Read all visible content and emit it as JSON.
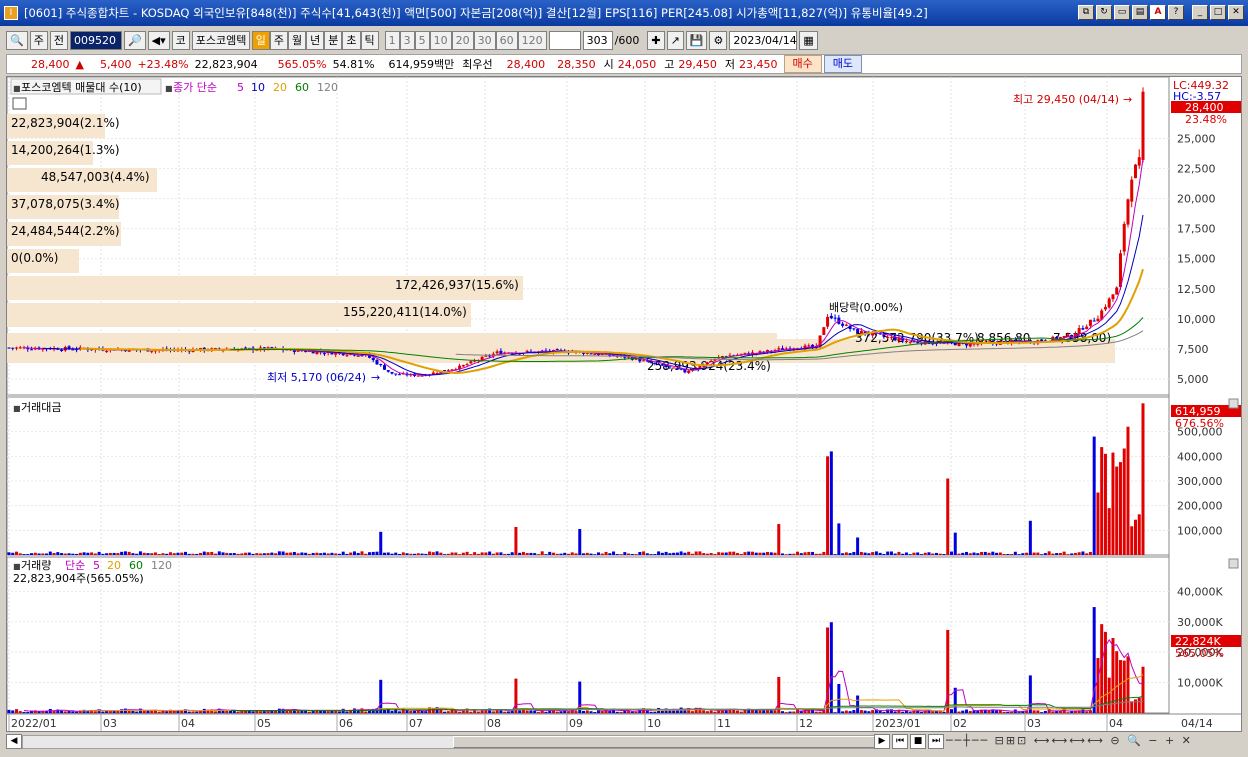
{
  "window": {
    "title": "[0601] 주식종합차트 - KOSDAQ 외국인보유[848(천)] 주식수[41,643(천)] 액면[500] 자본금[208(억)] 결산[12월] EPS[116] PER[245.08] 시가총액[11,827(억)] 유통비율[49.2]",
    "app_icon": "I"
  },
  "toolbar": {
    "market_select": "주",
    "prev_label": "전",
    "code": "009520",
    "stock_prefix": "코",
    "stock_name": "포스코엠텍",
    "periods": [
      "일",
      "주",
      "월",
      "년",
      "분",
      "초",
      "틱"
    ],
    "active_period": "일",
    "intervals": [
      "1",
      "3",
      "5",
      "10",
      "20",
      "30",
      "60",
      "120"
    ],
    "count": "303",
    "count_total": "/600",
    "date": "2023/04/14"
  },
  "quote": {
    "price": "28,400",
    "change": "5,400",
    "change_pct": "+23.48%",
    "volume": "22,823,904",
    "volume_ratio": "565.05%",
    "turnover": "54.81%",
    "amount": "614,959백만",
    "best_label": "최우선",
    "best_ask": "28,400",
    "best_bid": "28,350",
    "open_label": "시",
    "open": "24,050",
    "high_label": "고",
    "high": "29,450",
    "low_label": "저",
    "low": "23,450",
    "buy_label": "매수",
    "sell_label": "매도"
  },
  "price_panel": {
    "header": "포스코엠텍 매물대 수(10)",
    "ma_label": "종가 단순",
    "ma_periods": [
      "5",
      "10",
      "20",
      "60",
      "120"
    ],
    "ma_colors": [
      "#c000c0",
      "#0000c0",
      "#e0a000",
      "#008000",
      "#808080"
    ],
    "lc_text": "LC:449.32",
    "hc_text": "HC:-3.57",
    "current_price_tag": "28,400",
    "current_pct_tag": "23.48%",
    "high_note": "최고 29,450 (04/14)",
    "low_note": "최저 5,170 (06/24)",
    "dividend_note": "배당락(0.00%)",
    "yticks": [
      "25,000",
      "22,500",
      "20,000",
      "17,500",
      "15,000",
      "12,500",
      "10,000",
      "7,500",
      "5,000"
    ],
    "volume_profile": [
      "22,823,904(2.1%)",
      "14,200,264(1.3%)",
      "48,547,003(4.4%)",
      "37,078,075(3.4%)",
      "24,484,544(2.2%)",
      "0(0.0%)",
      "172,426,937(15.6%)",
      "155,220,411(14.0%)",
      "258,993,924(23.4%)",
      "372,572,790(33.7%)",
      "8,856,80",
      "7,538,00)"
    ]
  },
  "amount_panel": {
    "header": "거래대금",
    "current_tag": "614,959",
    "pct_tag": "676.56%",
    "yticks": [
      "500,000",
      "400,000",
      "300,000",
      "200,000",
      "100,000"
    ]
  },
  "volume_panel": {
    "header": "거래량",
    "ma_label": "단순",
    "ma_periods": [
      "5",
      "20",
      "60",
      "120"
    ],
    "ma_colors": [
      "#c000c0",
      "#e0a000",
      "#008000",
      "#808080"
    ],
    "value_text": "22,823,904주(565.05%)",
    "current_tag": "22,824K",
    "pct_tag": "565.05%",
    "yticks": [
      "40,000K",
      "30,000K",
      "20,000K",
      "10,000K"
    ]
  },
  "xaxis": {
    "labels": [
      "2022/01",
      "03",
      "04",
      "05",
      "06",
      "07",
      "08",
      "09",
      "10",
      "11",
      "12",
      "2023/01",
      "02",
      "03",
      "04"
    ],
    "right_label": "04/14"
  },
  "chart_data": {
    "type": "candlestick",
    "x_range": [
      "2022/01",
      "2023/04/14"
    ],
    "price_ylim": [
      4000,
      29450
    ],
    "key_points": [
      {
        "date": "2022/01",
        "close": 7600
      },
      {
        "date": "2022/06/24",
        "low": 5170
      },
      {
        "date": "2022/09",
        "close": 7200
      },
      {
        "date": "2022/12",
        "close": 10000
      },
      {
        "date": "2023/02",
        "close": 8000
      },
      {
        "date": "2023/03",
        "close": 11500
      },
      {
        "date": "2023/04/14",
        "open": 24050,
        "high": 29450,
        "low": 23450,
        "close": 28400
      }
    ]
  }
}
